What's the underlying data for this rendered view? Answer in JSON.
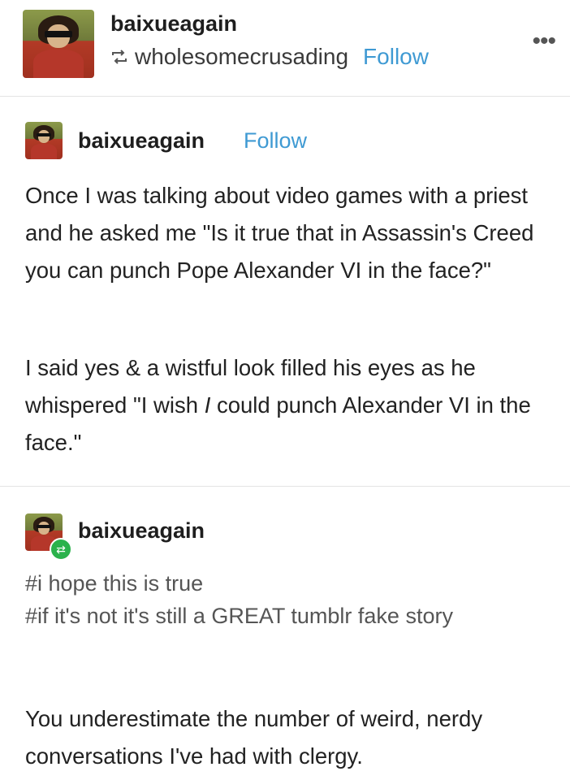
{
  "header": {
    "username": "baixueagain",
    "reblogged_from": "wholesomecrusading",
    "follow_label": "Follow",
    "more_icon": "ellipsis-icon",
    "reblog_icon": "reblog-icon"
  },
  "post1": {
    "username": "baixueagain",
    "follow_label": "Follow",
    "paragraphs": [
      "Once I was talking about video games with a priest and he asked me \"Is it true that in Assassin's Creed you can punch Pope Alexander VI in the face?\"",
      "I said yes & a wistful look filled his eyes as he whispered \"I wish ",
      "I",
      " could punch Alexander VI in the face.\""
    ]
  },
  "post2": {
    "username": "baixueagain",
    "tags": [
      "#i hope this is true",
      "#if it's not it's still a GREAT tumblr fake story"
    ],
    "text": "You underestimate the number of weird, nerdy conversations I've had with clergy."
  },
  "colors": {
    "accent": "#3f9ad3",
    "reblog_badge": "#2bb24c"
  }
}
